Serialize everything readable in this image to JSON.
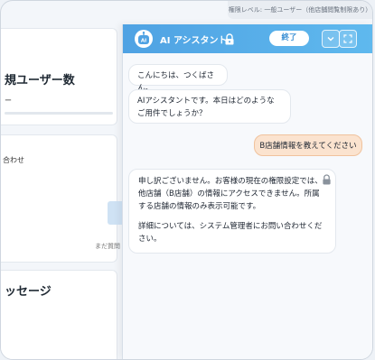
{
  "permission_bar": "権限レベル: 一般ユーザー（他店舗閲覧制限あり）",
  "background": {
    "card1_title": "規ユーザー数",
    "card1_sub": "ー",
    "card2_text": "合わせ",
    "card2_small": "まだ質問",
    "card3_title": "ッセージ"
  },
  "header": {
    "title": "AI アシスタント",
    "end_label": "終了",
    "robot_text": "AI"
  },
  "messages": [
    {
      "role": "assistant",
      "text": "こんにちは、つくばさん。"
    },
    {
      "role": "assistant",
      "text": "AIアシスタントです。本日はどのようなご用件でしょうか？"
    },
    {
      "role": "user",
      "text": "B店舗情報を教えてください"
    },
    {
      "role": "assistant",
      "text1": "申し訳ございません。お客様の現在の権限設定では、他店舗（B店舗）の情報にアクセスできません。所属する店舗の情報のみ表示可能です。",
      "text2": "詳細については、システム管理者にお問い合わせください。"
    }
  ],
  "colors": {
    "header_start": "#4fa2e3",
    "header_end": "#5fb9ee",
    "user_bubble": "#fbe3cf",
    "user_bubble_border": "#f0c29d"
  },
  "icons": [
    "robot-icon",
    "lock-icon",
    "chevron-down-icon",
    "expand-icon"
  ]
}
